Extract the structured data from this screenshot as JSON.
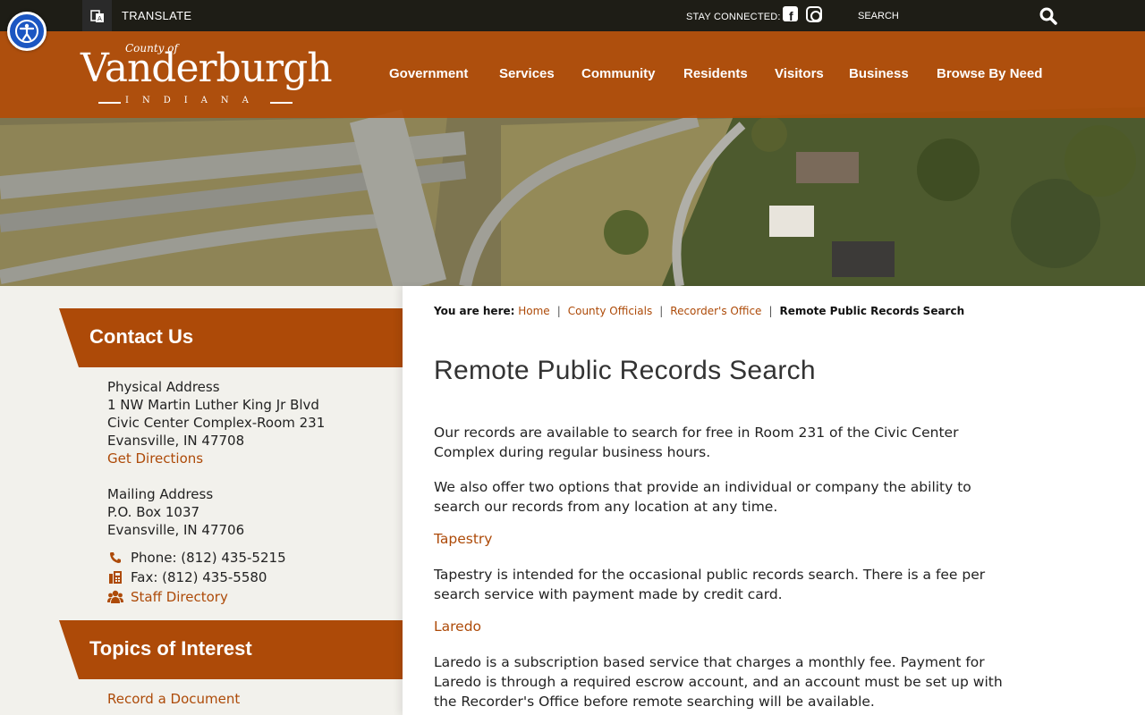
{
  "topbar": {
    "translate_label": "TRANSLATE",
    "stay_connected": "STAY CONNECTED:",
    "search_placeholder": "SEARCH"
  },
  "logo": {
    "county_of": "County of",
    "name": "Vanderburgh",
    "state": "INDIANA"
  },
  "nav": {
    "items": [
      "Government",
      "Services",
      "Community",
      "Residents",
      "Visitors",
      "Business",
      "Browse By Need"
    ]
  },
  "sidebar": {
    "contact_heading": "Contact Us",
    "physical_label": "Physical Address",
    "physical_line1": "1 NW Martin Luther King Jr Blvd",
    "physical_line2": "Civic Center Complex-Room 231",
    "physical_line3": "Evansville, IN 47708",
    "directions_link": "Get Directions",
    "mailing_label": "Mailing Address",
    "mailing_line1": "P.O. Box 1037",
    "mailing_line2": "Evansville, IN 47706",
    "phone": "Phone:  (812) 435-5215",
    "fax": "Fax:  (812) 435-5580",
    "staff_directory": "Staff Directory",
    "topics_heading": "Topics of Interest",
    "topics": [
      "Record a Document"
    ]
  },
  "breadcrumb": {
    "label": "You are here:",
    "items": [
      "Home",
      "County Officials",
      "Recorder's Office"
    ],
    "current": "Remote Public Records Search"
  },
  "main": {
    "title": "Remote Public Records Search",
    "p1": "Our records are available to search for free in Room 231 of the Civic Center Complex during regular business hours.",
    "p2": "We also offer two options that provide an individual or company the ability to search our records from any location at any time.",
    "link1": "Tapestry",
    "p3": "Tapestry is intended for the occasional public records search. There is a fee per search service with payment made by credit card.",
    "link2": "Laredo",
    "p4": "Laredo is a subscription based service that charges a monthly fee.  Payment for Laredo is through a required escrow account, and an account must be set up with the Recorder's Office before remote searching will be available."
  },
  "colors": {
    "brand_orange": "#ad4a08",
    "nav_band": "#b24c08",
    "accessibility_blue": "#1b56c2"
  },
  "icons": {
    "accessibility": "accessibility-icon",
    "translate": "translate-icon",
    "facebook": "facebook-icon",
    "instagram": "instagram-icon",
    "search": "search-icon",
    "phone": "phone-icon",
    "fax": "fax-icon",
    "staff": "users-icon"
  }
}
